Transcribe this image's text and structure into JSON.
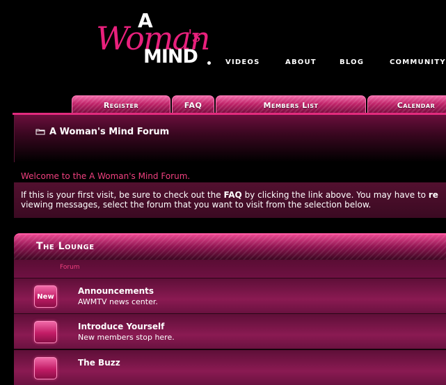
{
  "logo": {
    "script": "Woman",
    "word_a": "A",
    "word_apos": "'s",
    "word_mind": "MIND"
  },
  "topnav": [
    {
      "label": "VIDEOS"
    },
    {
      "label": "ABOUT"
    },
    {
      "label": "BLOG"
    },
    {
      "label": "COMMUNITY"
    }
  ],
  "tabs": [
    {
      "label": "Register"
    },
    {
      "label": "FAQ"
    },
    {
      "label": "Members List"
    },
    {
      "label": "Calendar"
    }
  ],
  "breadcrumb": {
    "title": "A Woman's Mind Forum",
    "icon": "folder-icon"
  },
  "welcome": {
    "title": "Welcome to the A Woman's Mind Forum.",
    "line1_a": "If this is your first visit, be sure to check out the ",
    "line1_faq": "FAQ",
    "line1_b": " by clicking the link above. You may have to ",
    "line1_reg": "re",
    "line2": "viewing messages, select the forum that you want to visit from the selection below."
  },
  "category": {
    "title": "The Lounge",
    "column_label": "Forum"
  },
  "forums": [
    {
      "status": "New",
      "name": "Announcements",
      "desc": "AWMTV news center."
    },
    {
      "status": "",
      "name": "Introduce Yourself",
      "desc": "New members stop here."
    },
    {
      "status": "",
      "name": "The Buzz",
      "desc": ""
    }
  ],
  "colors": {
    "accent": "#e22b7e",
    "welcome_text": "#f0407f",
    "background": "#000000"
  }
}
